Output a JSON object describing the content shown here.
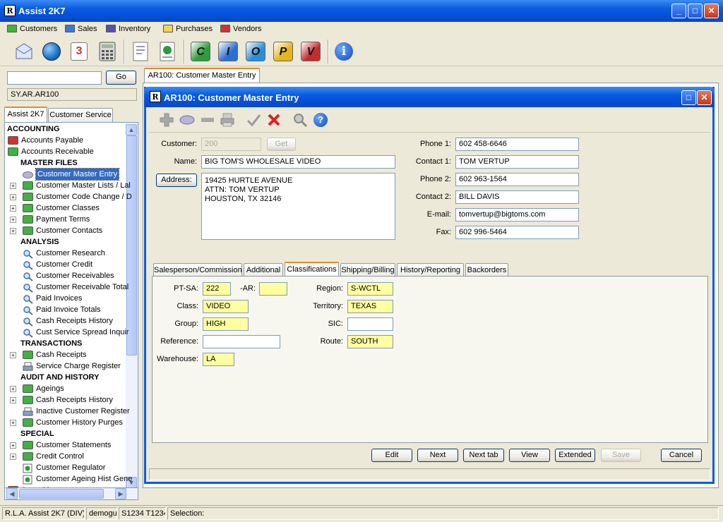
{
  "app": {
    "title": "Assist 2K7",
    "logo": "R"
  },
  "menu": [
    {
      "label": "Customers",
      "color": "#3fb23f"
    },
    {
      "label": "Sales",
      "color": "#3c7ad6"
    },
    {
      "label": "Inventory",
      "color": "#5a4fb0"
    },
    {
      "label": "Purchases",
      "color": "#f2d35a"
    },
    {
      "label": "Vendors",
      "color": "#d23232"
    }
  ],
  "toolbar": {
    "letters": [
      "C",
      "I",
      "O",
      "P",
      "V"
    ],
    "calendar_day": "3",
    "info_glyph": "i"
  },
  "left": {
    "search_value": "",
    "go_label": "Go",
    "path": "SY.AR.AR100",
    "tabs": [
      "Assist 2K7",
      "Customer Service"
    ],
    "tree": [
      {
        "label": "ACCOUNTING",
        "type": "header",
        "indent": 0
      },
      {
        "label": "Accounts Payable",
        "type": "folder",
        "color": "#d23232",
        "indent": 0
      },
      {
        "label": "Accounts Receivable",
        "type": "folder",
        "color": "#3fb23f",
        "indent": 0
      },
      {
        "label": "MASTER FILES",
        "type": "header",
        "indent": 1
      },
      {
        "label": "Customer Master Entry",
        "type": "item",
        "icon": "eraser-icon",
        "indent": 1,
        "selected": true
      },
      {
        "label": "Customer Master Lists / Lal",
        "type": "folder",
        "color": "#3fb23f",
        "indent": 1,
        "plus": true
      },
      {
        "label": "Customer Code Change / D",
        "type": "folder",
        "color": "#3fb23f",
        "indent": 1,
        "plus": true
      },
      {
        "label": "Customer Classes",
        "type": "folder",
        "color": "#3fb23f",
        "indent": 1,
        "plus": true
      },
      {
        "label": "Payment Terms",
        "type": "folder",
        "color": "#3fb23f",
        "indent": 1,
        "plus": true
      },
      {
        "label": "Customer Contacts",
        "type": "folder",
        "color": "#3fb23f",
        "indent": 1,
        "plus": true
      },
      {
        "label": "ANALYSIS",
        "type": "header",
        "indent": 1
      },
      {
        "label": "Customer Research",
        "type": "item",
        "icon": "magnifier-icon",
        "indent": 1
      },
      {
        "label": "Customer Credit",
        "type": "item",
        "icon": "magnifier-icon",
        "indent": 1
      },
      {
        "label": "Customer Receivables",
        "type": "item",
        "icon": "magnifier-icon",
        "indent": 1
      },
      {
        "label": "Customer Receivable Total",
        "type": "item",
        "icon": "magnifier-icon",
        "indent": 1
      },
      {
        "label": "Paid Invoices",
        "type": "item",
        "icon": "magnifier-icon",
        "indent": 1
      },
      {
        "label": "Paid Invoice Totals",
        "type": "item",
        "icon": "magnifier-icon",
        "indent": 1
      },
      {
        "label": "Cash Receipts History",
        "type": "item",
        "icon": "magnifier-icon",
        "indent": 1
      },
      {
        "label": "Cust Service Spread Inquir",
        "type": "item",
        "icon": "magnifier-icon",
        "indent": 1
      },
      {
        "label": "TRANSACTIONS",
        "type": "header",
        "indent": 1
      },
      {
        "label": "Cash Receipts",
        "type": "folder",
        "color": "#3fb23f",
        "indent": 1,
        "plus": true
      },
      {
        "label": "Service Charge Register",
        "type": "item",
        "icon": "printer-icon",
        "indent": 1
      },
      {
        "label": "AUDIT AND HISTORY",
        "type": "header",
        "indent": 1
      },
      {
        "label": "Ageings",
        "type": "folder",
        "color": "#3fb23f",
        "indent": 1,
        "plus": true
      },
      {
        "label": "Cash Receipts History",
        "type": "folder",
        "color": "#3fb23f",
        "indent": 1,
        "plus": true
      },
      {
        "label": "Inactive Customer Register",
        "type": "item",
        "icon": "printer-icon",
        "indent": 1
      },
      {
        "label": "Customer History Purges",
        "type": "folder",
        "color": "#3fb23f",
        "indent": 1,
        "plus": true
      },
      {
        "label": "SPECIAL",
        "type": "header",
        "indent": 1
      },
      {
        "label": "Customer Statements",
        "type": "folder",
        "color": "#3fb23f",
        "indent": 1,
        "plus": true
      },
      {
        "label": "Credit Control",
        "type": "folder",
        "color": "#3fb23f",
        "indent": 1,
        "plus": true
      },
      {
        "label": "Customer Regulator",
        "type": "item",
        "icon": "chart-icon",
        "indent": 1
      },
      {
        "label": "Customer Ageing Hist Gene",
        "type": "item",
        "icon": "chart-icon",
        "indent": 1
      },
      {
        "label": "Asset Management",
        "type": "folder",
        "color": "#d23232",
        "indent": 0
      }
    ]
  },
  "doc_tab": "AR100: Customer Master Entry",
  "form": {
    "title": "AR100: Customer Master Entry",
    "logo": "R",
    "labels": {
      "customer": "Customer:",
      "name": "Name:",
      "address_btn": "Address:",
      "phone1": "Phone 1:",
      "contact1": "Contact 1:",
      "phone2": "Phone 2:",
      "contact2": "Contact 2:",
      "email": "E-mail:",
      "fax": "Fax:"
    },
    "get_label": "Get",
    "customer": "200",
    "name": "BIG TOM'S WHOLESALE VIDEO",
    "address_lines": [
      "19425 HURTLE AVENUE",
      "ATTN: TOM VERTUP",
      "HOUSTON, TX 32146"
    ],
    "phone1": "602 458-6646",
    "contact1": "TOM VERTUP",
    "phone2": "602 963-1564",
    "contact2": "BILL DAVIS",
    "email": "tomvertup@bigtoms.com",
    "fax": "602 996-5464",
    "tabs": [
      "Salesperson/Commission",
      "Additional",
      "Classifications",
      "Shipping/Billing",
      "History/Reporting",
      "Backorders"
    ],
    "active_tab": "Classifications",
    "class_labels": {
      "ptsa": "PT-SA:",
      "ar": "-AR:",
      "class": "Class:",
      "group": "Group:",
      "reference": "Reference:",
      "warehouse": "Warehouse:",
      "region": "Region:",
      "territory": "Territory:",
      "sic": "SIC:",
      "route": "Route:"
    },
    "classifications": {
      "ptsa": "222",
      "ar": "",
      "class": "VIDEO",
      "group": "HIGH",
      "reference": "",
      "warehouse": "LA",
      "region": "S-WCTL",
      "territory": "TEXAS",
      "sic": "",
      "route": "SOUTH"
    },
    "buttons": {
      "edit": "Edit",
      "next": "Next",
      "next_tab": "Next tab",
      "view": "View",
      "extended": "Extended",
      "save": "Save",
      "cancel": "Cancel"
    }
  },
  "status": {
    "app": "R.L.A. Assist 2K7 (DIV)",
    "user": "demogui",
    "session": "S1234 T1234",
    "selection": "Selection:"
  }
}
